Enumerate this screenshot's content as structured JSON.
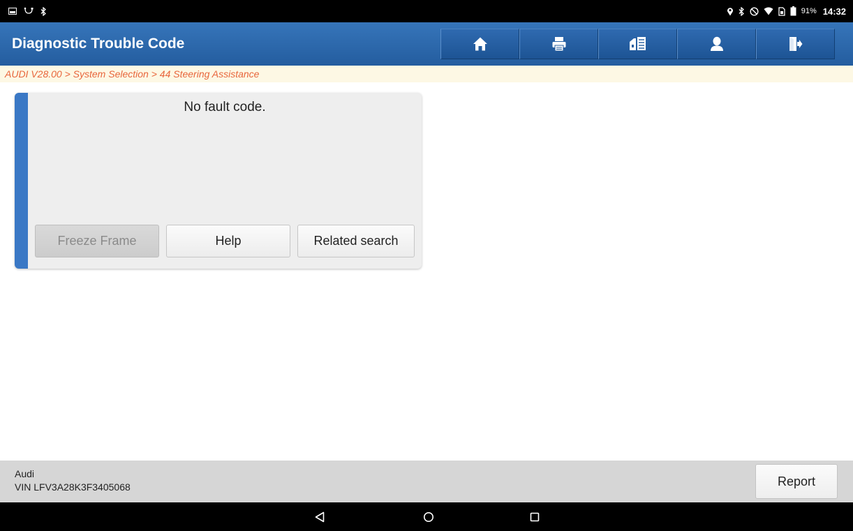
{
  "status_bar": {
    "battery_percent": "91%",
    "time": "14:32",
    "left_icons": [
      "gallery-notification-icon",
      "usb-debug-icon",
      "bluetooth-icon"
    ],
    "right_icons": [
      "location-icon",
      "bluetooth-icon",
      "do-not-disturb-icon",
      "wifi-icon",
      "sim-icon",
      "battery-icon"
    ]
  },
  "header": {
    "title": "Diagnostic Trouble Code",
    "toolbar": [
      {
        "name": "home",
        "icon": "home-icon"
      },
      {
        "name": "print",
        "icon": "printer-icon"
      },
      {
        "name": "data",
        "icon": "data-edit-icon"
      },
      {
        "name": "user",
        "icon": "user-icon"
      },
      {
        "name": "exit",
        "icon": "exit-icon"
      }
    ],
    "colors": {
      "bar": "#2f6eb4",
      "text": "#ffffff"
    }
  },
  "breadcrumb": {
    "text": "AUDI V28.00 > System Selection > 44 Steering Assistance",
    "color": "#e8663c"
  },
  "dtc_card": {
    "message": "No fault code.",
    "accent_color": "#3a78c5",
    "buttons": {
      "freeze_frame": "Freeze Frame",
      "help": "Help",
      "related_search": "Related search"
    }
  },
  "vehicle_info": {
    "make": "Audi",
    "vin": "VIN LFV3A28K3F3405068",
    "report_label": "Report"
  },
  "nav_bar": {
    "buttons": [
      "back-icon",
      "home-circle-icon",
      "recents-icon"
    ]
  }
}
